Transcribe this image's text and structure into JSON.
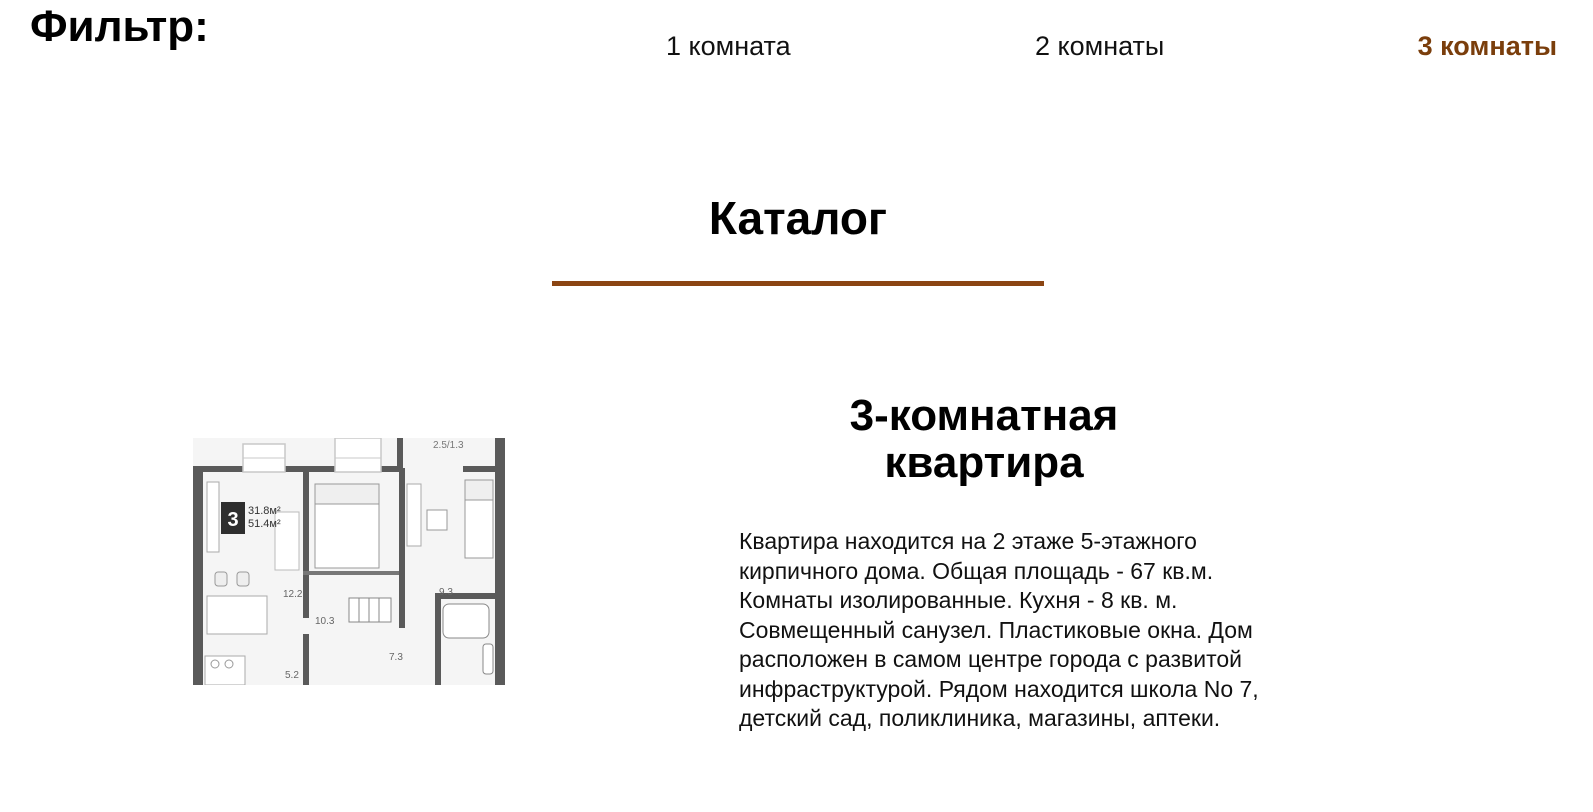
{
  "filter": {
    "title": "Фильтр:",
    "options": [
      {
        "label": "1 комната",
        "active": false
      },
      {
        "label": "2 комнаты",
        "active": false
      },
      {
        "label": "3 комнаты",
        "active": true
      }
    ]
  },
  "catalog": {
    "title": "Каталог",
    "accent_color": "#8b4513"
  },
  "card": {
    "title": "3-комнатная квартира",
    "description": "Квартира находится на 2 этаже 5-этажного кирпичного дома. Общая площадь - 67 кв.м. Комнаты изолированные. Кухня - 8 кв. м. Совмещенный санузел. Пластиковые окна. Дом расположен в самом центре города с развитой инфраструктурой. Рядом находится школа No 7, детский сад, поликлиника, магазины, аптеки.",
    "plan": {
      "rooms_badge": "3",
      "area_living": "31.8м²",
      "area_total": "51.4м²",
      "labels": [
        "2.5/1.3",
        "12.2",
        "10.3",
        "9.3",
        "7.3",
        "5.2"
      ]
    }
  }
}
